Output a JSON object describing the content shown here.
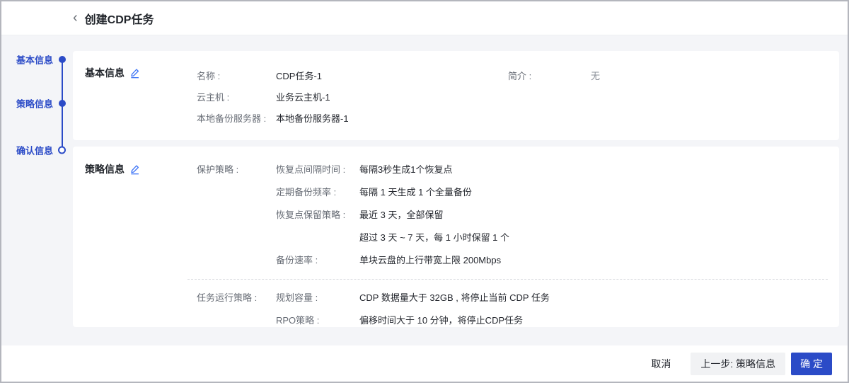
{
  "colors": {
    "accent_blue": "#2b4bc7",
    "edit_icon_blue": "#3d74f6",
    "page_background": "#f4f5f8",
    "label_gray": "#676c75",
    "value_dark": "#24272e"
  },
  "header": {
    "back_icon": "chevron-left",
    "title": "创建CDP任务"
  },
  "stepper": {
    "items": [
      {
        "label": "基本信息",
        "state": "done"
      },
      {
        "label": "策略信息",
        "state": "done"
      },
      {
        "label": "确认信息",
        "state": "current"
      }
    ]
  },
  "basic_card": {
    "title": "基本信息",
    "rows": [
      {
        "label": "名称 :",
        "value": "CDP任务-1"
      },
      {
        "label": "云主机 :",
        "value": "业务云主机-1"
      },
      {
        "label": "本地备份服务器 :",
        "value": "本地备份服务器-1"
      }
    ],
    "right_row": {
      "label": "简介 :",
      "value": "无"
    }
  },
  "policy_card": {
    "title": "策略信息",
    "groups": [
      {
        "label": "保护策略 :",
        "rows": [
          {
            "label": "恢复点间隔时间 :",
            "values": [
              "每隔3秒生成1个恢复点"
            ]
          },
          {
            "label": "定期备份频率 :",
            "values": [
              "每隔 1 天生成 1 个全量备份"
            ]
          },
          {
            "label": "恢复点保留策略 :",
            "values": [
              "最近 3 天，全部保留",
              "超过 3 天 ~ 7 天，每 1 小时保留 1 个"
            ]
          },
          {
            "label": "备份速率 :",
            "values": [
              "单块云盘的上行带宽上限 200Mbps"
            ]
          }
        ]
      },
      {
        "label": "任务运行策略 :",
        "rows": [
          {
            "label": "规划容量 :",
            "values": [
              "CDP 数据量大于 32GB , 将停止当前 CDP 任务"
            ]
          },
          {
            "label": "RPO策略 :",
            "values": [
              "偏移时间大于 10 分钟，将停止CDP任务"
            ]
          }
        ]
      }
    ]
  },
  "footer": {
    "cancel_label": "取消",
    "prev_label": "上一步: 策略信息",
    "confirm_label": "确 定"
  }
}
